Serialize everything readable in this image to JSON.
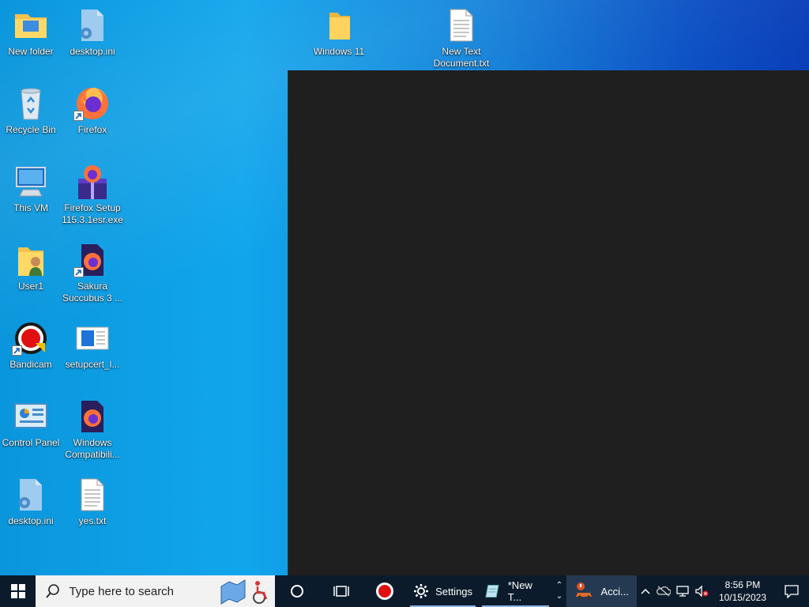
{
  "desktop": {
    "icons": [
      {
        "label": "New folder",
        "icon": "folder-icon"
      },
      {
        "label": "desktop.ini",
        "icon": "settings-file-icon"
      },
      {
        "label": "Windows 11",
        "icon": "folder-icon"
      },
      {
        "label": "New Text Document.txt",
        "icon": "text-file-icon"
      },
      {
        "label": "Recycle Bin",
        "icon": "recycle-bin-icon"
      },
      {
        "label": "Firefox",
        "icon": "firefox-icon"
      },
      {
        "label": "This VM",
        "icon": "computer-icon"
      },
      {
        "label": "Firefox Setup 115.3.1esr.exe",
        "icon": "firefox-installer-icon"
      },
      {
        "label": "User1",
        "icon": "user-folder-icon"
      },
      {
        "label": "Sakura Succubus 3 ...",
        "icon": "firefox-shortcut-icon"
      },
      {
        "label": "Bandicam",
        "icon": "bandicam-icon"
      },
      {
        "label": "setupcert_l...",
        "icon": "document-icon"
      },
      {
        "label": "Control Panel",
        "icon": "control-panel-icon"
      },
      {
        "label": "Windows Compatibili...",
        "icon": "firefox-shortcut-icon"
      },
      {
        "label": "desktop.ini",
        "icon": "settings-file-icon"
      },
      {
        "label": "yes.txt",
        "icon": "text-file-icon"
      }
    ]
  },
  "taskbar": {
    "search_placeholder": "Type here to search",
    "apps": [
      {
        "label": "",
        "icon": "cortana-circle-icon"
      },
      {
        "label": "",
        "icon": "task-view-icon"
      },
      {
        "label": "",
        "icon": "bandicam-record-icon"
      },
      {
        "label": "Settings",
        "icon": "gear-icon"
      },
      {
        "label": "*New T...",
        "icon": "notepad-icon"
      },
      {
        "label": "Acci...",
        "icon": "accident-app-icon"
      }
    ],
    "clock": {
      "time": "8:56 PM",
      "date": "10/15/2023"
    }
  },
  "colors": {
    "taskbar": "#0c1b2b",
    "desktop_accent": "#11a6ec",
    "dark_window": "#1f1f1f"
  }
}
